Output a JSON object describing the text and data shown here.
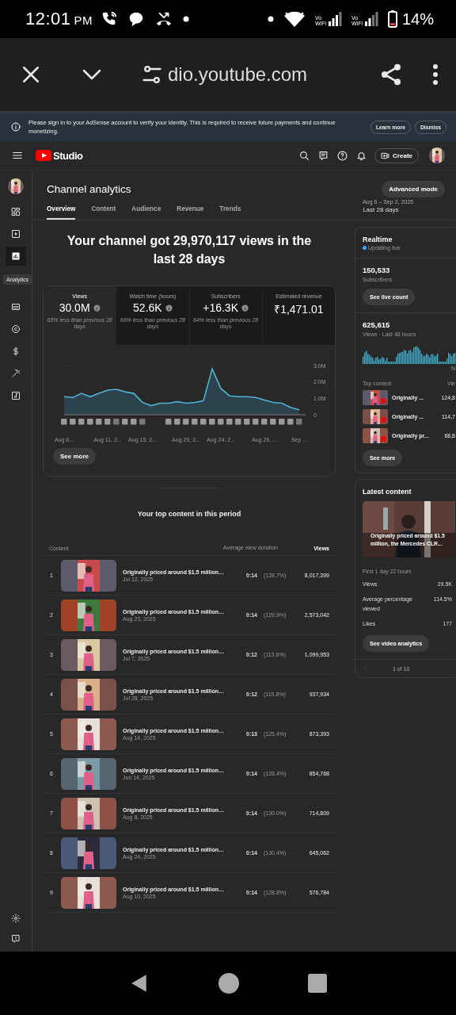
{
  "status_bar": {
    "time": "12:01",
    "meridiem": "PM",
    "network_labels": [
      "Vo WiFi",
      "Vo WiFi"
    ],
    "battery": "14%"
  },
  "browser": {
    "url": "dio.youtube.com"
  },
  "notice": {
    "text": "Please sign in to your AdSense account to verify your identity. This is required to receive future payments and continue monetizing.",
    "buttons": [
      "Learn more",
      "Dismiss"
    ]
  },
  "header": {
    "logo": "Studio",
    "create": "Create"
  },
  "sidebar": {
    "items": [
      {
        "kind": "dashboard",
        "selected": false
      },
      {
        "kind": "content",
        "selected": false
      },
      {
        "kind": "analytics",
        "selected": true
      },
      {
        "kind": "subtitles",
        "selected": false
      },
      {
        "kind": "copyright",
        "selected": false
      },
      {
        "kind": "earn",
        "selected": false
      },
      {
        "kind": "customization",
        "selected": false
      },
      {
        "kind": "audio",
        "selected": false
      }
    ],
    "tooltip": "Analytics"
  },
  "page": {
    "title": "Channel analytics",
    "mode_button": "Advanced mode",
    "date_range": "Aug 6 – Sep 2, 2025",
    "period": "Last 28 days",
    "tabs": [
      {
        "label": "Overview",
        "selected": true
      },
      {
        "label": "Content",
        "selected": false
      },
      {
        "label": "Audience",
        "selected": false
      },
      {
        "label": "Revenue",
        "selected": false
      },
      {
        "label": "Trends",
        "selected": false
      }
    ]
  },
  "summary": {
    "headline": "Your channel got 29,970,117 views in the last 28 days",
    "metrics": [
      {
        "label": "Views",
        "value": "30.0M",
        "info_icon": true,
        "note": "65% less than previous 28 days",
        "selected": true
      },
      {
        "label": "Watch time (hours)",
        "value": "52.6K",
        "info_icon": true,
        "note": "66% less than previous 28 days",
        "selected": false
      },
      {
        "label": "Subscribers",
        "value": "+16.3K",
        "info_icon": true,
        "note": "64% less than previous 28 days",
        "selected": false
      },
      {
        "label": "Estimated revenue",
        "value": "₹1,471.01",
        "info_icon": false,
        "selected": false
      }
    ],
    "chart_data": {
      "type": "area",
      "categories": [
        "Aug 6...",
        null,
        null,
        null,
        null,
        "Aug 11, 2...",
        null,
        null,
        null,
        "Aug 15, 2...",
        null,
        null,
        null,
        null,
        "Aug 20, 2...",
        null,
        null,
        null,
        "Aug 24, 2...",
        null,
        null,
        null,
        null,
        "Aug 29, ...",
        null,
        null,
        null,
        "Sep ..."
      ],
      "series": [
        {
          "color": "#4fb3d4",
          "values": [
            1.1,
            1.05,
            1.3,
            1.1,
            1.3,
            1.5,
            1.55,
            1.4,
            1.3,
            0.75,
            0.55,
            0.7,
            0.7,
            0.8,
            0.7,
            0.75,
            0.85,
            2.8,
            1.6,
            1.15,
            1.1,
            1.1,
            1.05,
            0.9,
            0.75,
            0.7,
            0.45,
            0.3
          ]
        }
      ],
      "ylim": [
        0,
        3
      ],
      "yticks": [
        {
          "value": 0,
          "label": "0"
        },
        {
          "value": 1,
          "label": "1.0M"
        },
        {
          "value": 2,
          "label": "2.0M"
        },
        {
          "value": 3,
          "label": "3.0M"
        }
      ]
    },
    "see_more": "See more"
  },
  "top_content": {
    "title": "Your top content in this period",
    "columns": [
      "Content",
      "Average view duration",
      "Views"
    ],
    "rows": [
      {
        "rank": "1",
        "title": "Originally priced around $1.5 million…",
        "date": "Jul 12, 2025",
        "duration": "0:14",
        "percent": "(128.7%)",
        "views": "8,017,399"
      },
      {
        "rank": "2",
        "title": "Originally priced around $1.5 million…",
        "date": "Aug 23, 2025",
        "duration": "0:14",
        "percent": "(129.9%)",
        "views": "2,573,042"
      },
      {
        "rank": "3",
        "title": "Originally priced around $1.5 million…",
        "date": "Jul 7, 2025",
        "duration": "0:12",
        "percent": "(113.6%)",
        "views": "1,099,953"
      },
      {
        "rank": "4",
        "title": "Originally priced around $1.5 million…",
        "date": "Jul 28, 2025",
        "duration": "0:12",
        "percent": "(115.8%)",
        "views": "937,934"
      },
      {
        "rank": "5",
        "title": "Originally priced around $1.5 million…",
        "date": "Aug 14, 2025",
        "duration": "0:13",
        "percent": "(125.4%)",
        "views": "873,393"
      },
      {
        "rank": "6",
        "title": "Originally priced around $1.5 million…",
        "date": "Jun 14, 2025",
        "duration": "0:14",
        "percent": "(128.4%)",
        "views": "854,768"
      },
      {
        "rank": "7",
        "title": "Originally priced around $1.5 million…",
        "date": "Aug 8, 2025",
        "duration": "0:14",
        "percent": "(130.0%)",
        "views": "714,809"
      },
      {
        "rank": "8",
        "title": "Originally priced around $1.5 million…",
        "date": "Aug 24, 2025",
        "duration": "0:14",
        "percent": "(130.4%)",
        "views": "645,062"
      },
      {
        "rank": "9",
        "title": "Originally priced around $1.5 million…",
        "date": "Aug 10, 2025",
        "duration": "0:14",
        "percent": "(128.8%)",
        "views": "576,784"
      }
    ]
  },
  "realtime": {
    "title": "Realtime",
    "status": "Updating live",
    "subscribers": "150,533",
    "subscribers_label": "Subscribers",
    "live_button": "See live count",
    "views": "625,615",
    "views_label": "Views · Last 48 hours",
    "axis_label": "N",
    "top_content_label": "Top content",
    "views_column": "Vie",
    "items": [
      {
        "title": "Originally ...",
        "views": "124,8"
      },
      {
        "title": "Originally ...",
        "views": "114,7"
      },
      {
        "title": "Originally pr...",
        "views": "68,8"
      }
    ],
    "see_more": "See more"
  },
  "latest": {
    "title": "Latest content",
    "video_title": "Originally priced around $1.5 million, the Mercedes CLR...",
    "period": "First 1 day 22 hours",
    "stats": [
      {
        "label": "Views",
        "value": "29.5K"
      },
      {
        "label": "Average percentage viewed",
        "value": "114.5%"
      },
      {
        "label": "Likes",
        "value": "177"
      }
    ],
    "button": "See video analytics",
    "pager": "1 of 10"
  }
}
